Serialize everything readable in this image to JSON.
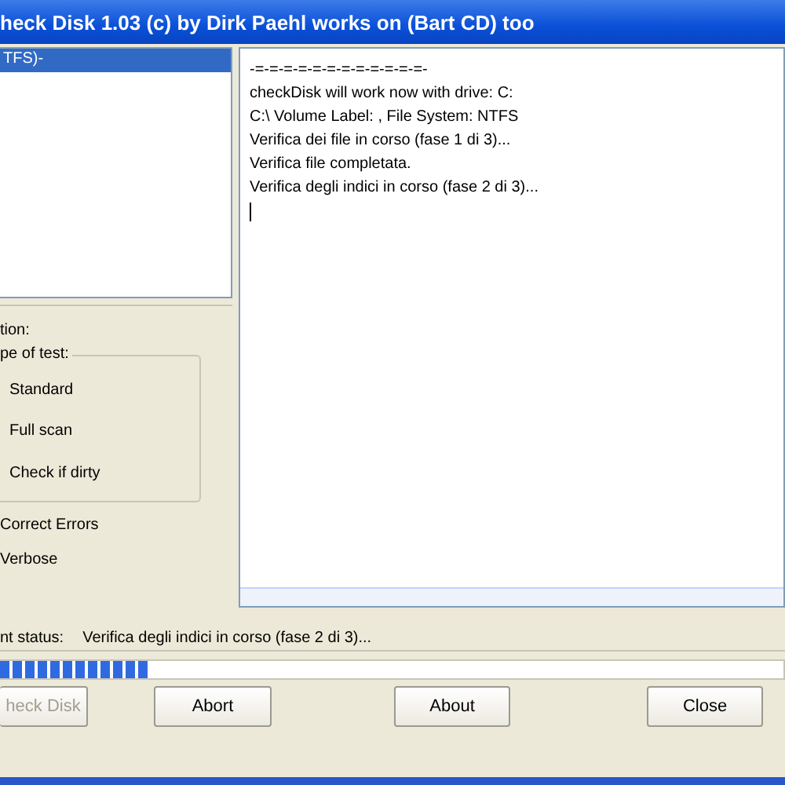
{
  "window": {
    "title": "heck Disk 1.03  (c) by Dirk Paehl works on (Bart CD) too"
  },
  "drive_list": {
    "items": [
      {
        "label": "TFS)-",
        "selected": true
      }
    ]
  },
  "options": {
    "label": "tion:",
    "test_type": {
      "label": "pe of test:",
      "items": [
        "Standard",
        "Full scan",
        "Check if dirty"
      ]
    },
    "checks": [
      "Correct Errors",
      "Verbose"
    ]
  },
  "log": {
    "lines": [
      "-=-=-=-=-=-=-=-=-=-=-=-=-",
      "checkDisk will work now with drive: C:",
      "C:\\ Volume Label: , File System: NTFS",
      "Verifica dei file in corso (fase 1 di 3)...",
      "Verifica file completata.",
      "Verifica degli indici in corso (fase 2 di 3)..."
    ]
  },
  "status": {
    "label": "nt status:",
    "value": "Verifica degli indici in corso (fase 2 di 3)..."
  },
  "progress": {
    "level": 0.19
  },
  "buttons": [
    {
      "label": "heck Disk",
      "disabled": true
    },
    {
      "label": "Abort",
      "disabled": false
    },
    {
      "label": "About",
      "disabled": false
    },
    {
      "label": "Close",
      "disabled": false
    }
  ]
}
